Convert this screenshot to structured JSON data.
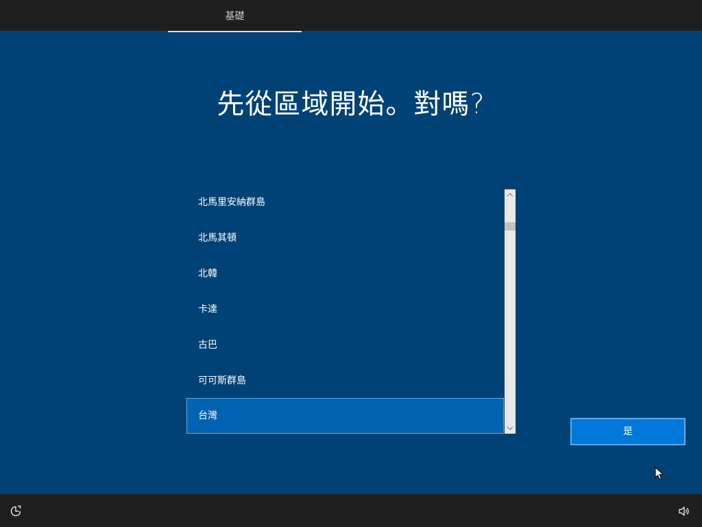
{
  "header": {
    "tab_label": "基礎"
  },
  "main": {
    "heading": "先從區域開始。對嗎?",
    "region_list": {
      "items": [
        {
          "label": "北馬里安納群島",
          "selected": false
        },
        {
          "label": "北馬其頓",
          "selected": false
        },
        {
          "label": "北韓",
          "selected": false
        },
        {
          "label": "卡達",
          "selected": false
        },
        {
          "label": "古巴",
          "selected": false
        },
        {
          "label": "可可斯群島",
          "selected": false
        },
        {
          "label": "台灣",
          "selected": true
        }
      ]
    },
    "yes_button_label": "是"
  },
  "footer": {
    "left_icon": "ease-of-access-icon",
    "right_icon": "volume-icon"
  },
  "colors": {
    "background": "#004275",
    "bar": "#1f1f1f",
    "selected_item": "#0063b1",
    "button": "#0078d7"
  }
}
